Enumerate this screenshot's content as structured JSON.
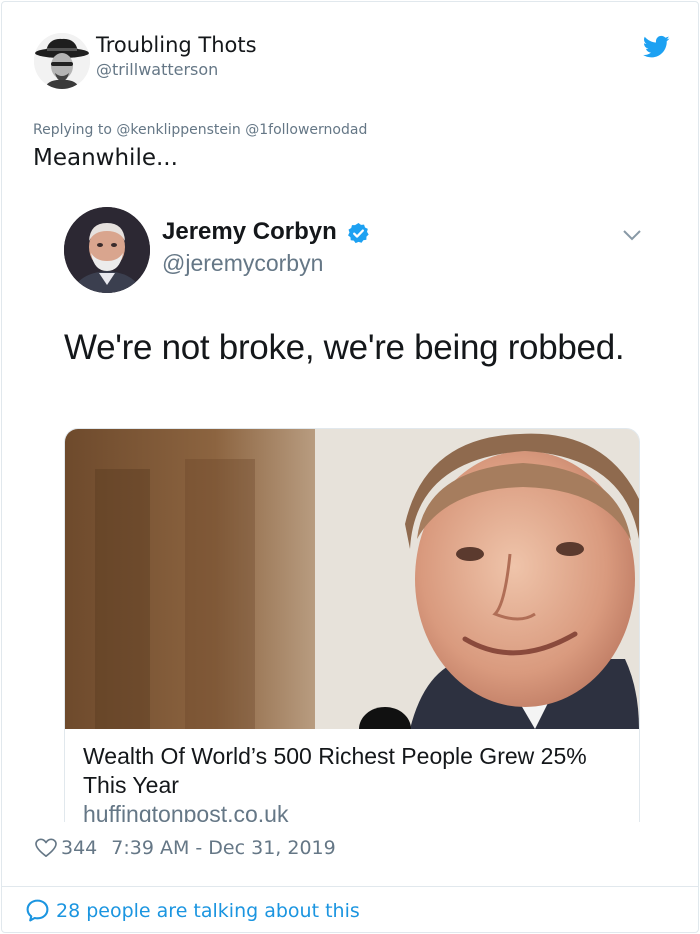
{
  "author": {
    "name": "Troubling Thots",
    "handle": "@trillwatterson",
    "avatar_icon": "man-in-fedora-avatar"
  },
  "brand_icon": "twitter-bird-icon",
  "reply_to": "Replying to @kenklippenstein @1followernodad",
  "tweet_text": "Meanwhile...",
  "embedded_tweet": {
    "name": "Jeremy Corbyn",
    "verified": true,
    "handle": "@jeremycorbyn",
    "text": "We're not broke, we're being robbed.",
    "link_card": {
      "image_icon": "man-smiling-photo",
      "title": "Wealth Of World’s 500 Richest People Grew 25% This Year",
      "domain": "huffingtonpost.co.uk"
    }
  },
  "stats": {
    "likes": "344",
    "timestamp": "7:39 AM - Dec 31, 2019"
  },
  "footer": {
    "talking": "28 people are talking about this"
  },
  "colors": {
    "text": "#14171a",
    "secondary": "#657786",
    "accent": "#1b95e0",
    "verified": "#1da1f2",
    "border": "#e1e8ed"
  }
}
